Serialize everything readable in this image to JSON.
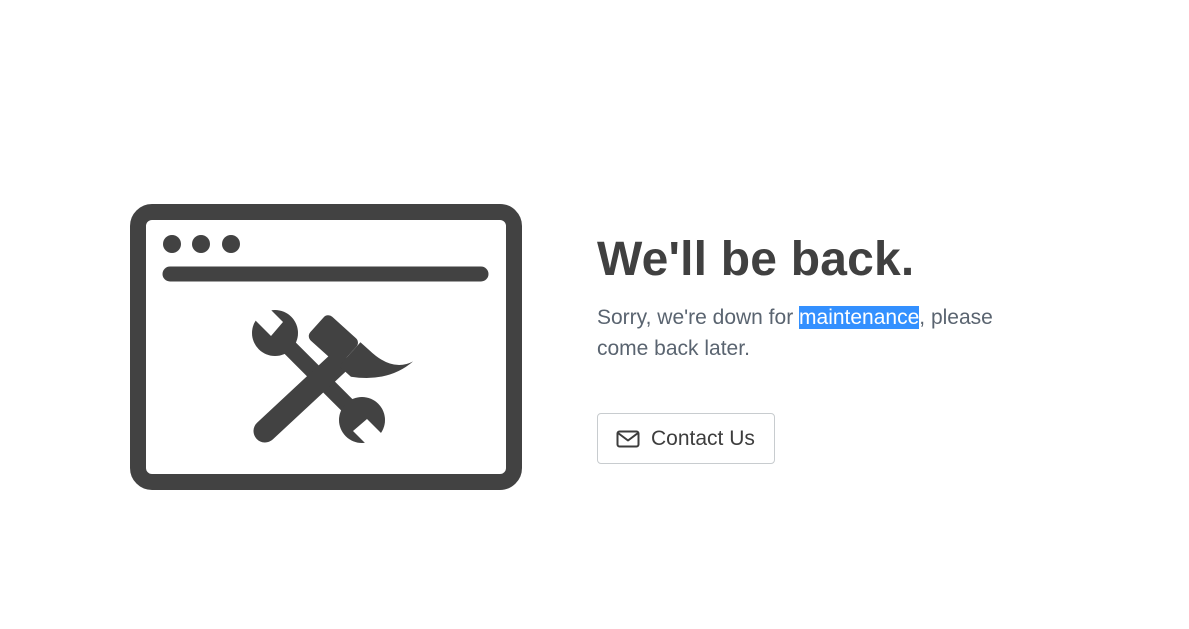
{
  "page": {
    "headline": "We'll be back.",
    "message_before": "Sorry, we're down for ",
    "message_highlight": "maintenance",
    "message_after": ", please come back later."
  },
  "contact_button": {
    "label": "Contact Us",
    "icon": "envelope-icon"
  },
  "illustration": {
    "icon": "browser-window-tools-icon",
    "color": "#424242"
  },
  "colors": {
    "headline": "#404040",
    "message": "#5a6470",
    "selection_highlight": "#3390ff",
    "button_border": "#c8cccf"
  }
}
